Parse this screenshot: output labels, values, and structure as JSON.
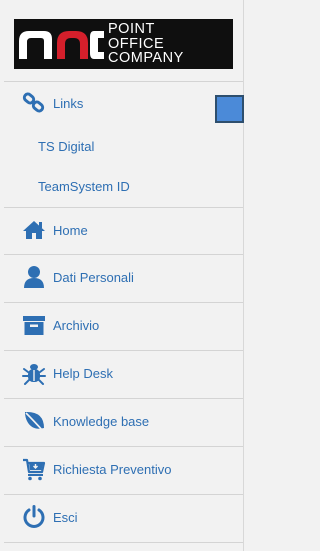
{
  "logo": {
    "line1": "POINT",
    "line2": "OFFICE",
    "line3": "COMPANY",
    "colors": {
      "background": "#0f0f0f",
      "red": "#d41f2b",
      "white": "#ffffff"
    }
  },
  "menu": {
    "links": "Links",
    "sub_items": [
      "TS Digital",
      "TeamSystem ID"
    ],
    "items": [
      {
        "label": "Home",
        "icon": "home-icon"
      },
      {
        "label": "Dati Personali",
        "icon": "user-icon"
      },
      {
        "label": "Archivio",
        "icon": "archive-icon"
      },
      {
        "label": "Help Desk",
        "icon": "bug-icon"
      },
      {
        "label": "Knowledge base",
        "icon": "leaf-icon"
      },
      {
        "label": "Richiesta Preventivo",
        "icon": "cart-icon"
      },
      {
        "label": "Esci",
        "icon": "power-icon"
      }
    ]
  },
  "colors": {
    "accent": "#2e6fb3",
    "background": "#f2f2f2",
    "toggle": "#4b8ad8"
  }
}
